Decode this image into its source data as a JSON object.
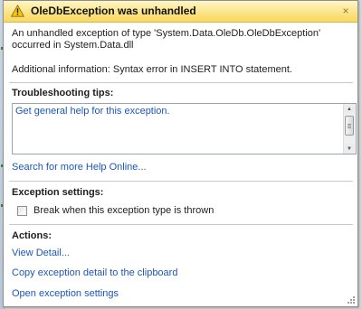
{
  "dialog": {
    "title": "OleDbException was unhandled",
    "close_glyph": "×",
    "message": "An unhandled exception of type 'System.Data.OleDb.OleDbException' occurred in System.Data.dll",
    "additional_info": "Additional information: Syntax error in INSERT INTO statement."
  },
  "troubleshooting": {
    "heading": "Troubleshooting tips:",
    "tips": [
      "Get general help for this exception."
    ],
    "search_link": "Search for more Help Online..."
  },
  "exception_settings": {
    "heading": "Exception settings:",
    "checkbox_label": "Break when this exception type is thrown",
    "checked": false
  },
  "actions": {
    "heading": "Actions:",
    "items": [
      "View Detail...",
      "Copy exception detail to the clipboard",
      "Open exception settings"
    ]
  },
  "colors": {
    "title_bar": "#f7d85f",
    "link": "#1b57b5",
    "warning": "#f2c200"
  }
}
